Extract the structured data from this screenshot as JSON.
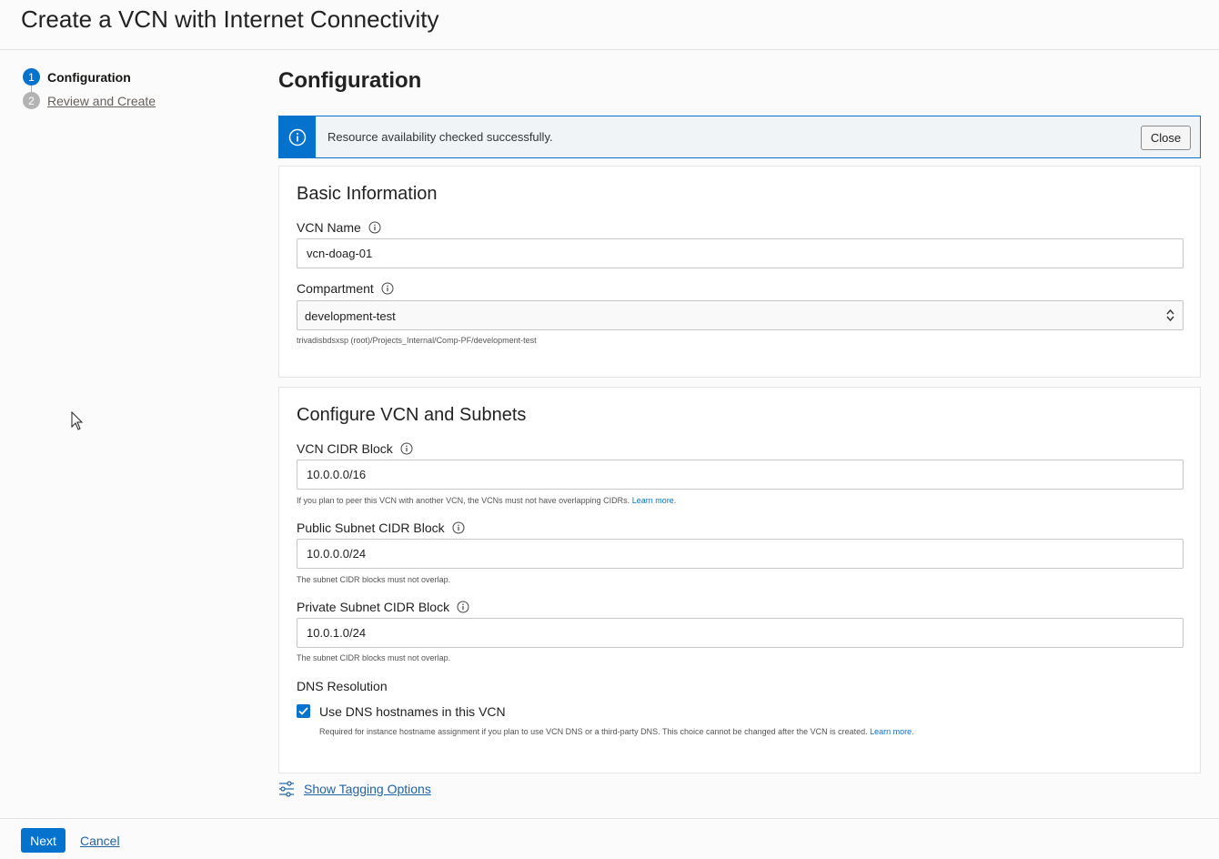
{
  "page": {
    "title": "Create a VCN with Internet Connectivity"
  },
  "steps": [
    {
      "number": "1",
      "label": "Configuration"
    },
    {
      "number": "2",
      "label": "Review and Create"
    }
  ],
  "main": {
    "title": "Configuration"
  },
  "alert": {
    "message": "Resource availability checked successfully.",
    "close_label": "Close",
    "icon": "info-icon"
  },
  "basic_info": {
    "title": "Basic Information",
    "vcn_name": {
      "label": "VCN Name",
      "value": "vcn-doag-01"
    },
    "compartment": {
      "label": "Compartment",
      "value": "development-test",
      "path": "trivadisbdsxsp (root)/Projects_Internal/Comp-PF/development-test"
    }
  },
  "vcn_config": {
    "title": "Configure VCN and Subnets",
    "vcn_cidr": {
      "label": "VCN CIDR Block",
      "value": "10.0.0.0/16",
      "help": "If you plan to peer this VCN with another VCN, the VCNs must not have overlapping CIDRs.",
      "help_link": "Learn more."
    },
    "public_subnet": {
      "label": "Public Subnet CIDR Block",
      "value": "10.0.0.0/24",
      "help": "The subnet CIDR blocks must not overlap."
    },
    "private_subnet": {
      "label": "Private Subnet CIDR Block",
      "value": "10.0.1.0/24",
      "help": "The subnet CIDR blocks must not overlap."
    },
    "dns": {
      "label": "DNS Resolution",
      "checkbox_label": "Use DNS hostnames in this VCN",
      "checked": true,
      "help": "Required for instance hostname assignment if you plan to use VCN DNS or a third-party DNS. This choice cannot be changed after the VCN is created.",
      "help_link": "Learn more."
    }
  },
  "tagging": {
    "label": "Show Tagging Options"
  },
  "footer": {
    "next_label": "Next",
    "cancel_label": "Cancel"
  },
  "colors": {
    "accent": "#0572ce",
    "link": "#2164a6"
  }
}
